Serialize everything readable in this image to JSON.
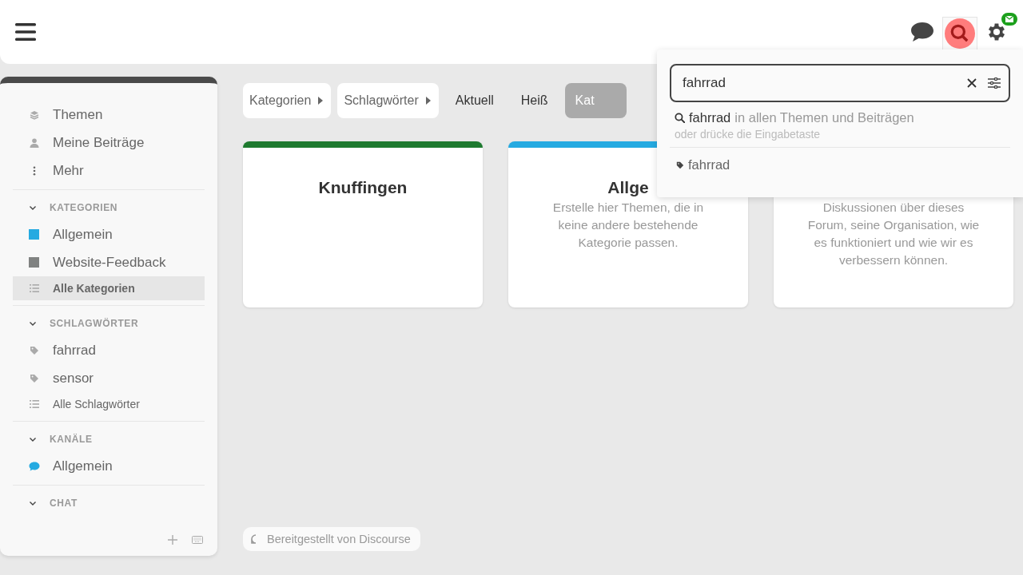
{
  "header": {
    "search_active": true
  },
  "sidebar": {
    "items": [
      {
        "kind": "layers",
        "label": "Themen",
        "selected": false
      },
      {
        "kind": "user",
        "label": "Meine Beiträge",
        "selected": false
      },
      {
        "kind": "more",
        "label": "Mehr",
        "selected": false
      }
    ],
    "sections": [
      {
        "title": "KATEGORIEN",
        "expanded": true,
        "items": [
          {
            "kind": "category",
            "label": "Allgemein",
            "color": "#25aae1",
            "selected": false
          },
          {
            "kind": "category",
            "label": "Website-Feedback",
            "color": "#808281",
            "selected": false
          },
          {
            "kind": "all",
            "label": "Alle Kategorien",
            "selected": true
          }
        ]
      },
      {
        "title": "SCHLAGWÖRTER",
        "expanded": true,
        "items": [
          {
            "kind": "tag",
            "label": "fahrrad",
            "selected": false
          },
          {
            "kind": "tag",
            "label": "sensor",
            "selected": false
          },
          {
            "kind": "all",
            "label": "Alle Schlagwörter",
            "selected": false
          }
        ]
      },
      {
        "title": "KANÄLE",
        "expanded": true,
        "items": [
          {
            "kind": "channel",
            "label": "Allgemein",
            "color": "#25aae1",
            "selected": false
          }
        ]
      },
      {
        "title": "CHAT",
        "expanded": true
      }
    ]
  },
  "nav": [
    {
      "kind": "dropdown",
      "label": "Kategorien",
      "selected": false
    },
    {
      "kind": "dropdown",
      "label": "Schlagwörter",
      "selected": false
    },
    {
      "kind": "link",
      "label": "Aktuell",
      "selected": false
    },
    {
      "kind": "link",
      "label": "Heiß",
      "selected": false
    },
    {
      "kind": "link",
      "label": "Kat",
      "selected": true
    }
  ],
  "cards": [
    {
      "title": "Knuffingen",
      "color": "#1e7a2f"
    },
    {
      "title": "Allge",
      "color": "#25aae1",
      "description": "Erstelle hier Themen, die in keine andere bestehende Kategorie passen."
    },
    {
      "description": "Diskussionen über dieses Forum, seine Organisation, wie es funktioniert und wie wir es verbessern können."
    }
  ],
  "footer": {
    "text": "Bereitgestellt von Discourse"
  },
  "search_menu": {
    "query": "fahrrad",
    "full_search": {
      "term": "fahrrad",
      "rest": "in allen Themen und Beiträgen",
      "hint": "oder drücke die Eingabetaste"
    },
    "results": [
      {
        "kind": "tag",
        "label": "fahrrad"
      }
    ]
  }
}
